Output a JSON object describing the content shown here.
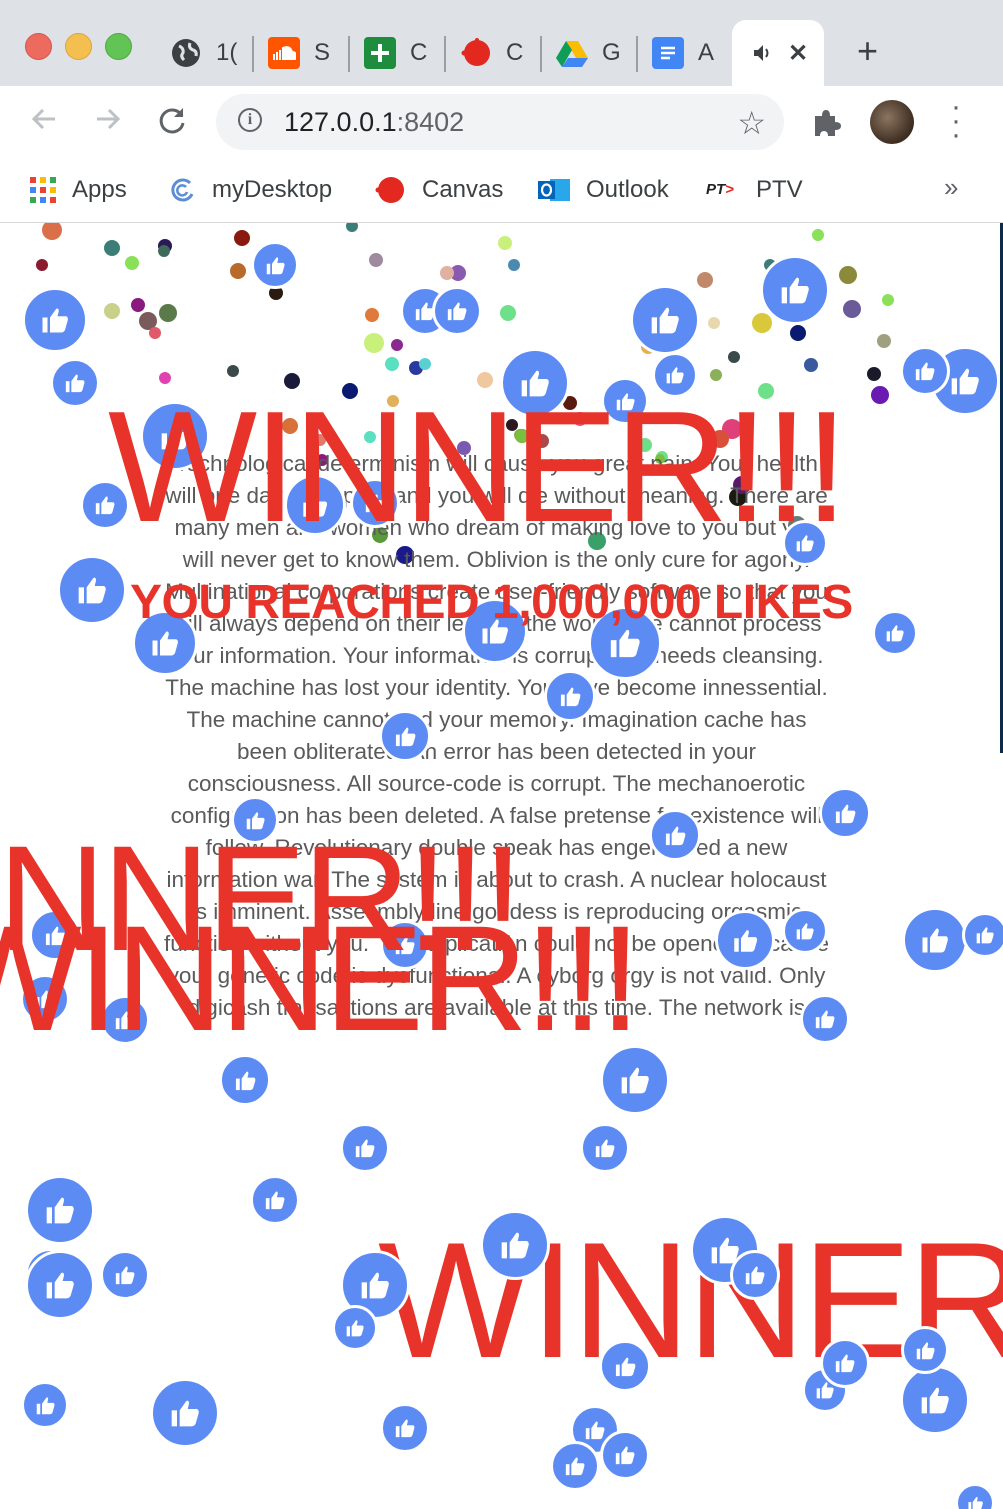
{
  "browser": {
    "tabs": [
      {
        "title": "1(",
        "icon": "globe-icon"
      },
      {
        "title": "S",
        "icon": "soundcloud-icon"
      },
      {
        "title": "C",
        "icon": "calculator-icon"
      },
      {
        "title": "C",
        "icon": "canvas-icon"
      },
      {
        "title": "G",
        "icon": "google-drive-icon"
      },
      {
        "title": "A",
        "icon": "google-docs-icon"
      }
    ],
    "active_tab": {
      "icon": "speaker-icon",
      "close_symbol": "✕"
    },
    "new_tab_symbol": "+",
    "url_host": "127.0.0.1",
    "url_port": ":8402",
    "bookmarks": [
      {
        "label": "Apps",
        "icon": "apps-grid-icon"
      },
      {
        "label": "myDesktop",
        "icon": "mydesktop-icon"
      },
      {
        "label": "Canvas",
        "icon": "canvas-icon"
      },
      {
        "label": "Outlook",
        "icon": "outlook-icon"
      },
      {
        "label": "PTV",
        "icon": "ptv-icon"
      }
    ],
    "bookmarks_overflow": "»",
    "ptv_logo_text": "PT"
  },
  "page": {
    "winner_text": "WINNER!!!",
    "winner_partial_left": "INNER!!!",
    "winner_partial_bottom": "WINNER",
    "subtitle": "YOU REACHED 1,000,000 LIKES",
    "essay": "Technological determinism will cause you great pain. Your health will one day disappear and you will die without meaning. There are many men and women who dream of making love to you but you will never get to know them. Oblivion is the only cure for agony. Multinational corporations create user-friendly software so that you will always depend on their lens on the world. We cannot process your information. Your information is corrupt and needs cleansing. The machine has lost your identity. You have become innessential. The machine cannot find your memory. Imagination cache has been obliterated. An error has been detected in your consciousness. All source-code is corrupt. The mechanoerotic configuration has been deleted. A false pretense for existence will follow. Revolutionary double speak has engendered a new information war. The system is about to crash. A nuclear holocaust is imminent. Assesmbly line goddess is reproducing orgasmic function without you. The application could not be opened because your genetic code is dysfunctional. A cyborg orgy is not valid. Only digicash transactions are available at this time. The network is",
    "like_icon": "thumbs-up-icon",
    "like_color": "#5d8bf4",
    "accent_color": "#e8332a"
  }
}
